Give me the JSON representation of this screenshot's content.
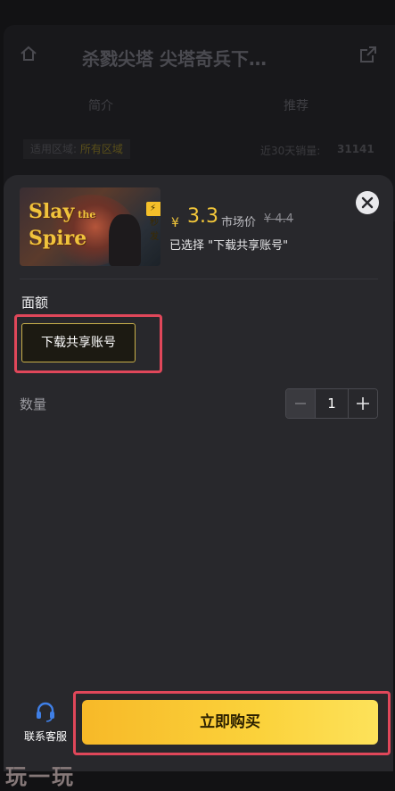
{
  "header": {
    "title": "杀戮尖塔 尖塔奇兵下…",
    "icons": {
      "home": "home-icon",
      "share": "share-icon"
    }
  },
  "tabs": [
    {
      "label": "简介"
    },
    {
      "label": "推荐"
    }
  ],
  "info": {
    "region_label": "适用区域:",
    "region_value": "所有区域",
    "sales_label": "近30天销量:",
    "sales_value": "31141"
  },
  "product": {
    "cover_logo_top": "Slay",
    "cover_logo_the": "the",
    "cover_logo_bottom": "Spire",
    "badge": "秒发",
    "currency": "¥",
    "price": "3.3",
    "market_label": "市场价",
    "market_price": "¥ 4.4",
    "selected_text": "已选择 \"下载共享账号\""
  },
  "denomination": {
    "label": "面额",
    "options": [
      {
        "label": "下载共享账号",
        "selected": true
      }
    ]
  },
  "quantity": {
    "label": "数量",
    "value": "1"
  },
  "footer": {
    "customer_service_label": "联系客服",
    "buy_label": "立即购买"
  },
  "watermark": "玩一玩",
  "colors": {
    "accent": "#f3c73a",
    "buy_gradient_start": "#f7b928",
    "buy_gradient_end": "#fde25a",
    "highlight_box": "#e0475a",
    "headset_icon": "#3f7fe6"
  }
}
